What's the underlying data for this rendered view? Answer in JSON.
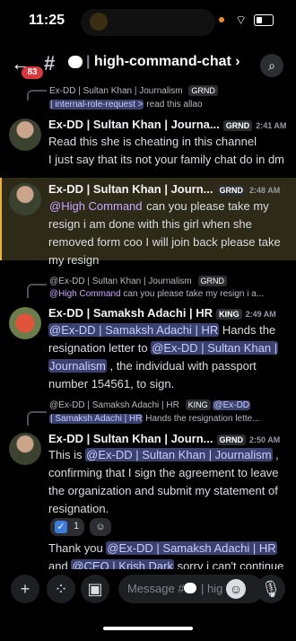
{
  "status": {
    "time": "11:25"
  },
  "header": {
    "unread_badge": "83",
    "channel": "high-command-chat",
    "chevron": "›"
  },
  "messages": [
    {
      "reply_author": "Ex-DD | Sultan Khan | Journalism",
      "reply_tag": "GRND",
      "reply_mention": "| internal-role-request >",
      "reply_text": "read this allao"
    },
    {
      "author": "Ex-DD | Sultan Khan | Journa...",
      "tag": "GRND",
      "time": "2:41 AM",
      "line1": "Read this she is cheating in this channel",
      "line2": "I just say that its not your family chat do in dm"
    },
    {
      "author": "Ex-DD | Sultan Khan | Journ...",
      "tag": "GRND",
      "time": "2:48 AM",
      "mention": "@High Command",
      "line1": " can you please take my",
      "line2": "resign i am done with this girl when she",
      "line3": "removed form coo I will join back please take",
      "line4": "my resign"
    },
    {
      "reply_author": "@Ex-DD | Sultan Khan | Journalism",
      "reply_tag": "GRND",
      "reply_mention": "@High Command",
      "reply_text": "can you please take my resign i a..."
    },
    {
      "author": "Ex-DD | Samaksh Adachi | HR",
      "tag": "KING",
      "time": "2:49 AM",
      "mention1": "@Ex-DD | Samaksh Adachi | HR",
      "text1": " Hands the",
      "text2": "resignation letter to ",
      "mention2": "@Ex-DD | Sultan Khan |",
      "mention3": "Journalism",
      "text3": " , the individual with passport",
      "text4": "number 154561, to sign."
    },
    {
      "reply_author": "@Ex-DD | Samaksh Adachi | HR",
      "reply_tag": "KING",
      "reply_mention": "@Ex-DD",
      "reply_mention2": "| Samaksh Adachi | HR",
      "reply_text": "Hands the resignation lette..."
    },
    {
      "author": "Ex-DD | Sultan Khan | Journ...",
      "tag": "GRND",
      "time": "2:50 AM",
      "text1": "This is ",
      "mention1": "@Ex-DD | Sultan Khan | Journalism",
      "text1b": " ,",
      "text2": "confirming that I sign the agreement to leave",
      "text3": "the organization and submit my statement of",
      "text4": "resignation.",
      "reaction_count": "1",
      "text5": "Thank you ",
      "mention2": "@Ex-DD | Samaksh Adachi | HR",
      "text6": "and ",
      "mention3": "@CEO | Krish Dark",
      "text6b": " sorry i can't continue"
    }
  ],
  "composer": {
    "placeholder": "Message #",
    "placeholder_tail": "| hig"
  }
}
